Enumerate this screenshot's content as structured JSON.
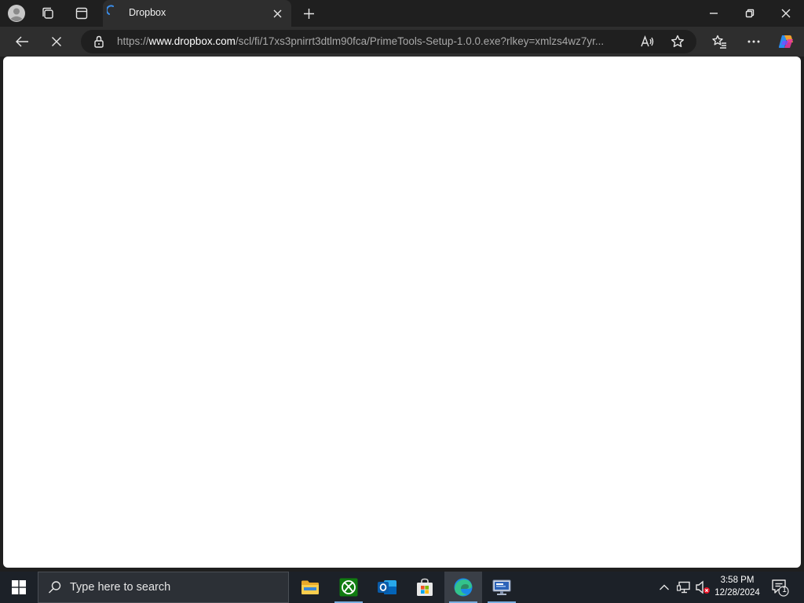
{
  "browser": {
    "tab": {
      "title": "Dropbox"
    },
    "address": {
      "prefix": "https://",
      "host": "www.dropbox.com",
      "path": "/scl/fi/17xs3pnirrt3dtlm90fca/PrimeTools-Setup-1.0.0.exe?rlkey=xmlzs4wz7yr..."
    }
  },
  "taskbar": {
    "search_placeholder": "Type here to search",
    "time": "3:58 PM",
    "date": "12/28/2024",
    "notification_count": "1"
  }
}
